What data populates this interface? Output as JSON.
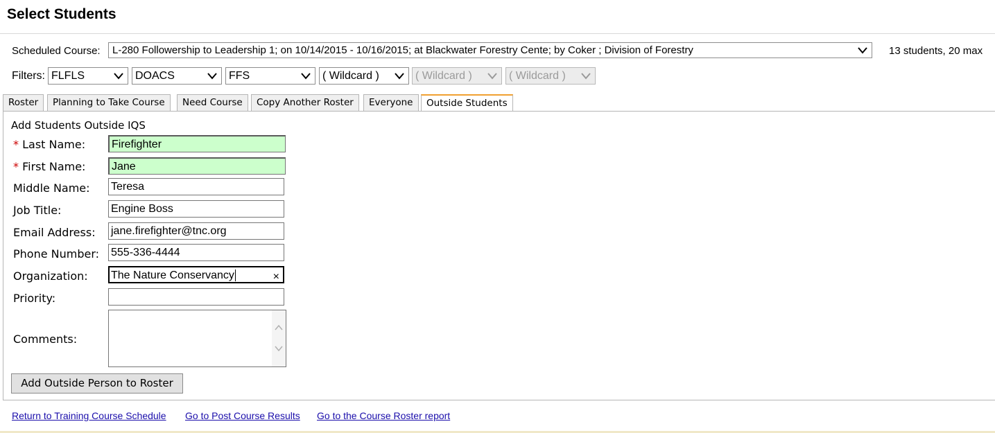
{
  "page": {
    "title": "Select Students"
  },
  "course": {
    "label": "Scheduled Course:",
    "selected": "L-280 Followership to Leadership 1; on 10/14/2015 - 10/16/2015; at Blackwater Forestry Cente; by Coker ; Division of Forestry",
    "capacity": "13 students, 20 max"
  },
  "filters": {
    "label": "Filters:",
    "values": [
      "FLFLS",
      "DOACS",
      "FFS",
      "( Wildcard )",
      "( Wildcard )",
      "( Wildcard )"
    ]
  },
  "tabs": [
    {
      "label": "Roster"
    },
    {
      "label": "Planning to Take Course"
    },
    {
      "label": "Need Course"
    },
    {
      "label": "Copy Another Roster"
    },
    {
      "label": "Everyone"
    },
    {
      "label": "Outside Students",
      "active": true
    }
  ],
  "form": {
    "heading": "Add Students Outside IQS",
    "required_mark": "*",
    "fields": [
      {
        "label": "Last Name:",
        "value": "Firefighter"
      },
      {
        "label": "First Name:",
        "value": "Jane"
      },
      {
        "label": "Middle Name:",
        "value": "Teresa"
      },
      {
        "label": "Job Title:",
        "value": "Engine Boss"
      },
      {
        "label": "Email Address:",
        "value": "jane.firefighter@tnc.org"
      },
      {
        "label": "Phone Number:",
        "value": "555-336-4444"
      },
      {
        "label": "Organization:",
        "value": "The Nature Conservancy"
      },
      {
        "label": "Priority:",
        "value": ""
      },
      {
        "label": "Comments:",
        "value": ""
      }
    ],
    "clear_glyph": "×",
    "submit_label": "Add Outside Person to Roster"
  },
  "links": [
    "Return to Training Course Schedule",
    "Go to Post Course Results",
    "Go to the Course Roster report"
  ],
  "colors": {
    "required_fill": "#ccffcc",
    "active_tab_accent": "#f0a030",
    "link": "#1a0dab"
  }
}
